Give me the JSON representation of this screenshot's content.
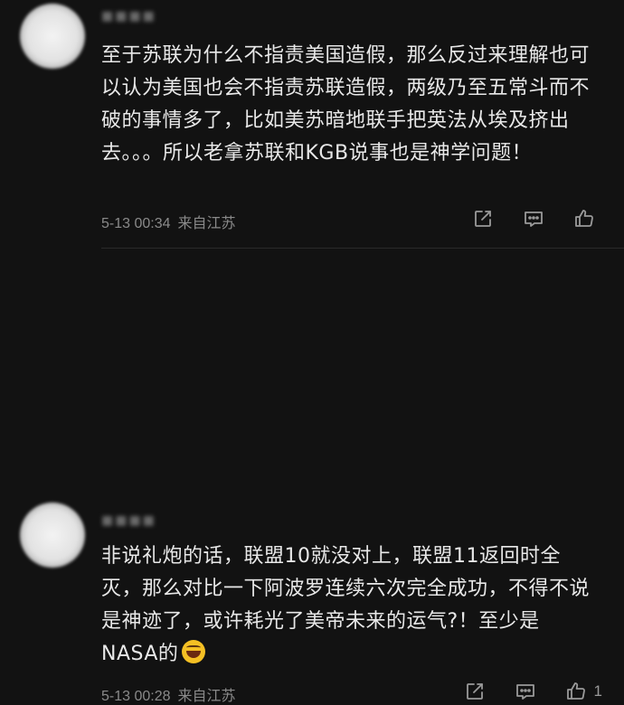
{
  "comments": [
    {
      "text": "至于苏联为什么不指责美国造假，那么反过来理解也可以认为美国也会不指责苏联造假，两级乃至五常斗而不破的事情多了，比如美苏暗地联手把英法从埃及挤出去。。。所以老拿苏联和KGB说事也是神学问题！",
      "time": "5-13 00:34",
      "location": "来自江苏",
      "like_count": ""
    },
    {
      "text": "非说礼炮的话，联盟10就没对上，联盟11返回时全灭，那么对比一下阿波罗连续六次完全成功，不得不说是神迹了，或许耗光了美帝未来的运气?！至少是NASA的",
      "time": "5-13 00:28",
      "location": "来自江苏",
      "like_count": "1"
    }
  ],
  "icons": {
    "share": "share-icon",
    "reply": "comment-icon",
    "like": "thumbs-up-icon",
    "emoji": "laughing-emoji-icon"
  }
}
